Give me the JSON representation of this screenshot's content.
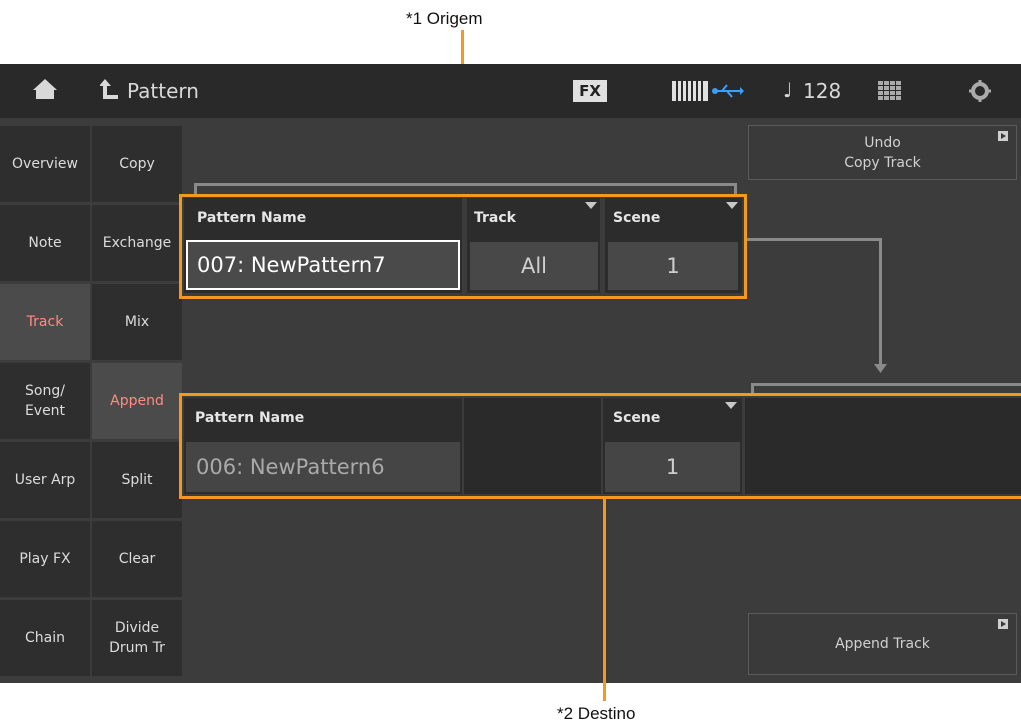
{
  "callouts": {
    "source": "*1 Origem",
    "destination": "*2 Destino"
  },
  "header": {
    "title": "Pattern",
    "fx_label": "FX",
    "tempo_note": "♩",
    "tempo": "128"
  },
  "left_tabs": [
    "Overview",
    "Note",
    "Track",
    "Song/\nEvent",
    "User Arp",
    "Play FX",
    "Chain"
  ],
  "sub_tabs": [
    "Copy",
    "Exchange",
    "Mix",
    "Append",
    "Split",
    "Clear",
    "Divide\nDrum Tr"
  ],
  "active_left_tab": "Track",
  "active_sub_tab": "Append",
  "source": {
    "pattern_name_label": "Pattern Name",
    "pattern_name_value": "007: NewPattern7",
    "track_label": "Track",
    "track_value": "All",
    "scene_label": "Scene",
    "scene_value": "1"
  },
  "destination": {
    "pattern_name_label": "Pattern Name",
    "pattern_name_value": "006: NewPattern6",
    "scene_label": "Scene",
    "scene_value": "1"
  },
  "buttons": {
    "undo": "Undo\nCopy Track",
    "append_track": "Append Track"
  },
  "colors": {
    "accent_orange": "#f39a1e",
    "active_tab_text": "#ff8c80",
    "usb_blue": "#3aa0ff"
  }
}
